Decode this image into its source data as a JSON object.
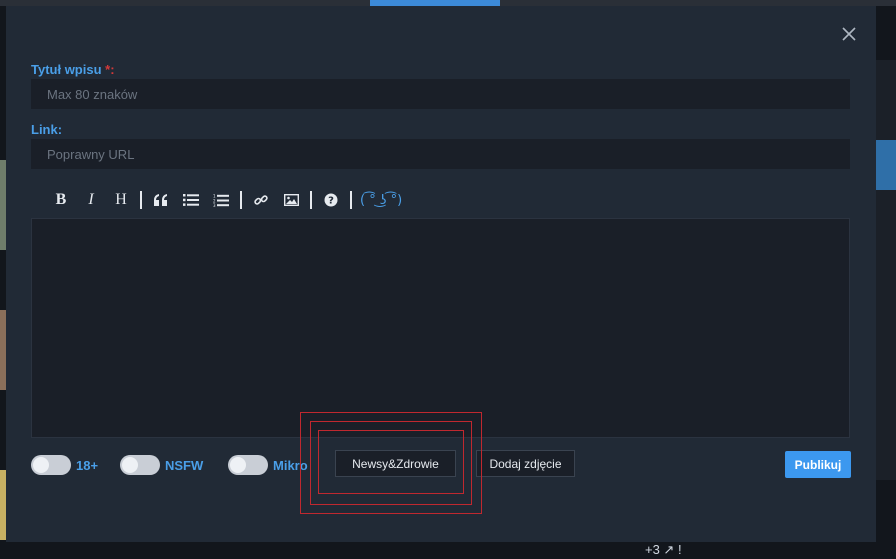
{
  "background": {
    "footer_text": "+3 ↗ !"
  },
  "modal": {
    "close_icon": "close-icon",
    "title_field": {
      "label": "Tytuł wpisu",
      "required_mark": "*:",
      "placeholder": "Max 80 znaków",
      "value": ""
    },
    "link_field": {
      "label": "Link:",
      "placeholder": "Poprawny URL",
      "value": ""
    },
    "toolbar": {
      "bold": "B",
      "italic": "I",
      "heading": "H",
      "quote_icon": "quote-icon",
      "unordered_list_icon": "list-icon",
      "ordered_list_icon": "ordered-list-icon",
      "link_icon": "link-icon",
      "image_icon": "image-icon",
      "help_icon": "help-icon",
      "lenny_face": "( ͡° ͜ʖ ͡°)"
    },
    "editor": {
      "value": ""
    },
    "toggles": [
      {
        "label": "18+",
        "on": false
      },
      {
        "label": "NSFW",
        "on": false
      },
      {
        "label": "Mikro",
        "on": false
      }
    ],
    "category_button": "Newsy&Zdrowie",
    "add_photo_button": "Dodaj zdjęcie",
    "publish_button": "Publikuj"
  },
  "colors": {
    "modal_bg": "#212a36",
    "accent": "#4a9fe8",
    "publish": "#3c98ef",
    "required": "#d63a3a",
    "highlight": "#c0282f"
  }
}
